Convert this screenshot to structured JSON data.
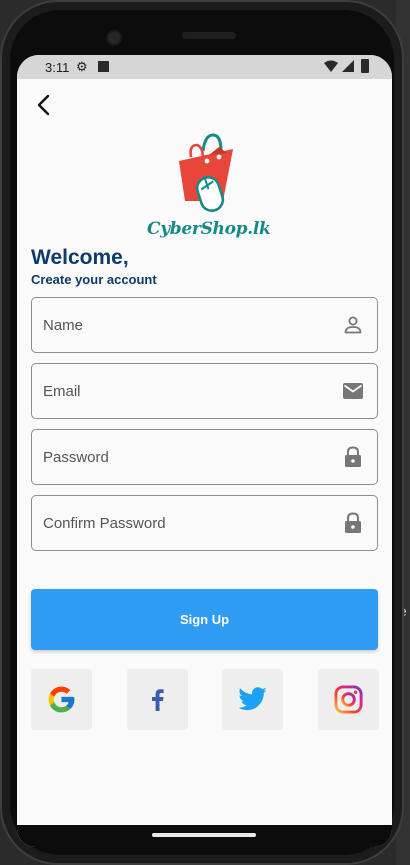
{
  "status_bar": {
    "time": "3:11"
  },
  "logo": {
    "text": "CyberShop.lk",
    "colors": {
      "bag": "#e8463a",
      "accent": "#168b85"
    }
  },
  "header": {
    "title": "Welcome,",
    "subtitle": "Create your account"
  },
  "form": {
    "name": {
      "placeholder": "Name",
      "icon": "person-icon"
    },
    "email": {
      "placeholder": "Email",
      "icon": "mail-icon"
    },
    "password": {
      "placeholder": "Password",
      "icon": "lock-icon"
    },
    "confirm_password": {
      "placeholder": "Confirm Password",
      "icon": "lock-icon"
    }
  },
  "signup": {
    "label": "Sign Up",
    "color": "#2f9bf3"
  },
  "social": [
    "google-icon",
    "facebook-icon",
    "twitter-icon",
    "instagram-icon"
  ],
  "ide": {
    "edge_char": "e"
  }
}
